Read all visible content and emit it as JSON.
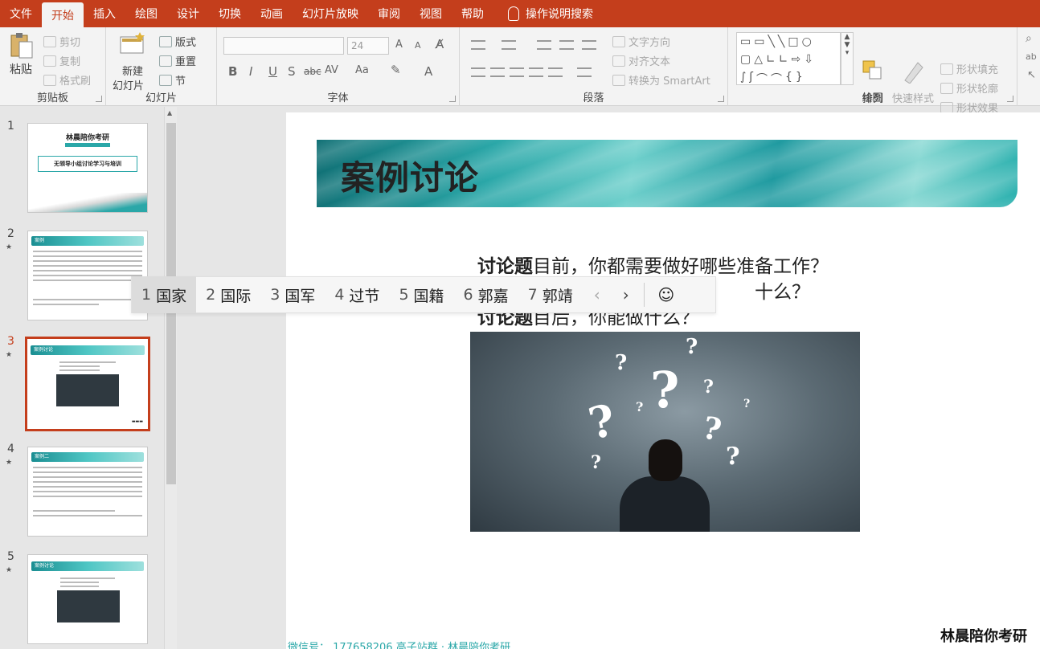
{
  "menu": {
    "tabs": [
      "文件",
      "开始",
      "插入",
      "绘图",
      "设计",
      "切换",
      "动画",
      "幻灯片放映",
      "审阅",
      "视图",
      "帮助"
    ],
    "active_tab": "开始",
    "search": "操作说明搜索"
  },
  "ribbon": {
    "clipboard": {
      "label": "剪贴板",
      "paste": "粘贴",
      "cut": "剪切",
      "copy": "复制",
      "format_painter": "格式刷"
    },
    "slides": {
      "label": "幻灯片",
      "new_slide_1": "新建",
      "new_slide_2": "幻灯片",
      "layout": "版式",
      "reset": "重置",
      "section": "节"
    },
    "font": {
      "label": "字体",
      "font_name": "",
      "font_size": "24",
      "bold": "B",
      "italic": "I",
      "underline": "U",
      "shadow": "S",
      "strike": "abc",
      "spacing": "AV",
      "case": "Aa",
      "font_color": "A",
      "grow": "A",
      "shrink": "A"
    },
    "paragraph": {
      "label": "段落",
      "text_direction": "文字方向",
      "align_text": "对齐文本",
      "smartart": "转换为 SmartArt"
    },
    "drawing": {
      "label": "绘图",
      "arrange": "排列",
      "quick_styles": "快速样式",
      "shape_fill": "形状填充",
      "shape_outline": "形状轮廓",
      "shape_effects": "形状效果"
    }
  },
  "thumbnails": [
    {
      "num": "1",
      "title": "林晨陪你考研",
      "subtitle": "无领导小组讨论学习与培训"
    },
    {
      "num": "2",
      "title": "案例"
    },
    {
      "num": "3",
      "title": "案例讨论"
    },
    {
      "num": "4",
      "title": "案例二"
    },
    {
      "num": "5",
      "title": "案例讨论"
    }
  ],
  "slide": {
    "title": "案例讨论",
    "q1_bold": "讨论题",
    "q1_text": "目前，你都需要做好哪些准备工作？",
    "q2_tail": "十么？",
    "q3_bold": "讨论题",
    "q3_text": "目后，你能做什么？",
    "footer_logo": "林晨陪你考研",
    "footer_text": "微信号：    177658206    高子站群 · 林晨陪你考研"
  },
  "ime": {
    "candidates": [
      {
        "n": "1",
        "text": "国家"
      },
      {
        "n": "2",
        "text": "国际"
      },
      {
        "n": "3",
        "text": "国军"
      },
      {
        "n": "4",
        "text": "过节"
      },
      {
        "n": "5",
        "text": "国籍"
      },
      {
        "n": "6",
        "text": "郭嘉"
      },
      {
        "n": "7",
        "text": "郭靖"
      }
    ],
    "prev": "‹",
    "next": "›",
    "emoji": "☺"
  },
  "colors": {
    "accent": "#c43e1c",
    "teal": "#2aa7a8"
  }
}
